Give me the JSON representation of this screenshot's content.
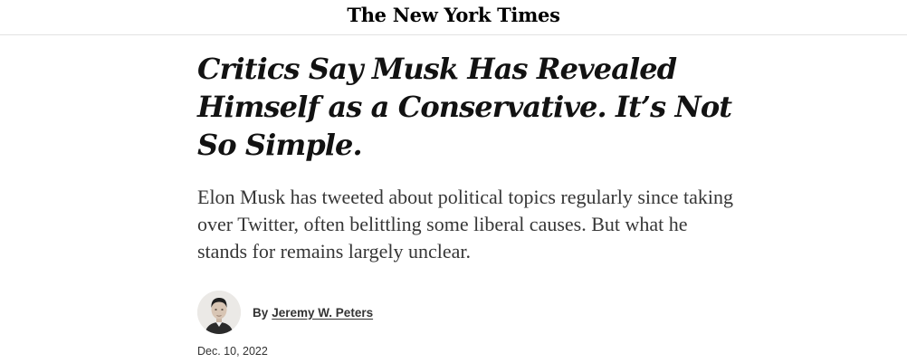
{
  "masthead": {
    "logo_text": "The New York Times"
  },
  "article": {
    "headline": "Critics Say Musk Has Revealed Himself as a Conservative. It’s Not So Simple.",
    "summary": "Elon Musk has tweeted about political topics regularly since taking over Twitter, often belittling some liberal causes. But what he stands for remains largely unclear.",
    "byline": {
      "prefix": "By",
      "author": "Jeremy W. Peters"
    },
    "date": "Dec. 10, 2022"
  }
}
